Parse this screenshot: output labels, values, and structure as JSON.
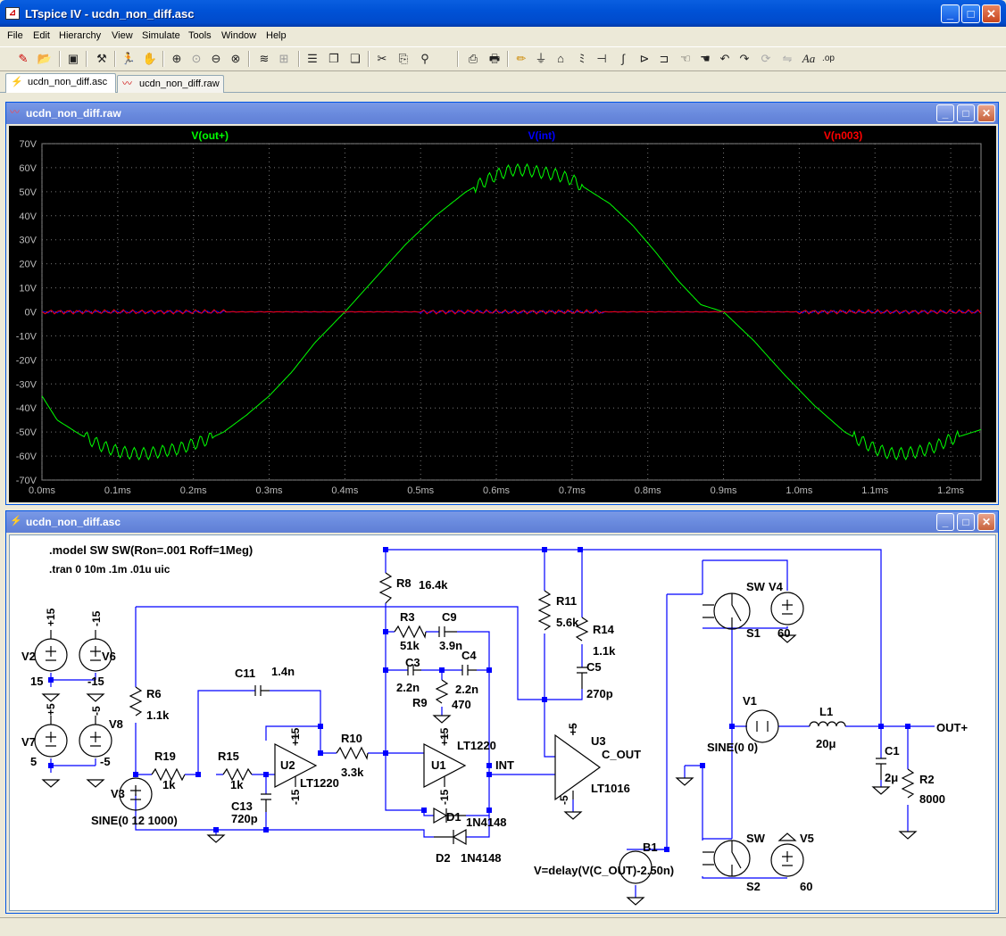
{
  "window": {
    "title": "LTspice IV - ucdn_non_diff.asc"
  },
  "menu": [
    "File",
    "Edit",
    "Hierarchy",
    "View",
    "Simulate",
    "Tools",
    "Window",
    "Help"
  ],
  "tabs": [
    {
      "label": "ucdn_non_diff.asc"
    },
    {
      "label": "ucdn_non_diff.raw"
    }
  ],
  "plot_window": {
    "title": "ucdn_non_diff.raw"
  },
  "schematic_window": {
    "title": "ucdn_non_diff.asc"
  },
  "colors": {
    "trace_out": "#00ff00",
    "trace_int": "#0000ff",
    "trace_n003": "#ff0000",
    "wire": "#0000ff",
    "component": "#000000",
    "junction": "#0000ff"
  },
  "chart_data": {
    "type": "line",
    "series": [
      {
        "name": "V(out+)",
        "color": "#00ff00",
        "x": [
          0.0,
          0.02,
          0.05,
          0.08,
          0.1,
          0.12,
          0.14,
          0.16,
          0.18,
          0.2,
          0.22,
          0.24,
          0.27,
          0.3,
          0.33,
          0.36,
          0.4,
          0.44,
          0.48,
          0.52,
          0.56,
          0.6,
          0.62,
          0.64,
          0.66,
          0.68,
          0.7,
          0.72,
          0.75,
          0.78,
          0.81,
          0.84,
          0.87,
          0.9,
          0.94,
          0.98,
          1.02,
          1.06,
          1.1,
          1.12,
          1.14,
          1.16,
          1.18,
          1.2,
          1.22,
          1.24
        ],
        "y": [
          -35,
          -45,
          -51,
          -56,
          -58,
          -59,
          -59,
          -58,
          -57,
          -55,
          -53,
          -50,
          -43,
          -35,
          -25,
          -13,
          0,
          14,
          28,
          40,
          50,
          57,
          59,
          59,
          58,
          57,
          55,
          51,
          45,
          36,
          25,
          13,
          3,
          0,
          -12,
          -26,
          -39,
          -50,
          -57,
          -59,
          -59,
          -58,
          -56,
          -53,
          -51,
          -49
        ]
      },
      {
        "name": "V(int)",
        "color": "#0000ff",
        "x": [
          0,
          1.24
        ],
        "y": [
          0,
          0
        ]
      },
      {
        "name": "V(n003)",
        "color": "#ff0000",
        "x": [
          0,
          1.24
        ],
        "y": [
          0,
          0
        ]
      }
    ],
    "yticks": [
      "70V",
      "60V",
      "50V",
      "40V",
      "30V",
      "20V",
      "10V",
      "0V",
      "-10V",
      "-20V",
      "-30V",
      "-40V",
      "-50V",
      "-60V",
      "-70V"
    ],
    "xticks": [
      "0.0ms",
      "0.1ms",
      "0.2ms",
      "0.3ms",
      "0.4ms",
      "0.5ms",
      "0.6ms",
      "0.7ms",
      "0.8ms",
      "0.9ms",
      "1.0ms",
      "1.1ms",
      "1.2ms"
    ],
    "ylim": [
      -70,
      70
    ],
    "xlim": [
      0,
      1.24
    ],
    "grid": true
  },
  "schematic": {
    "directives": [
      ".model SW SW(Ron=.001 Roff=1Meg)",
      ".tran 0 10m .1m .01u uic"
    ],
    "labels": {
      "r8": "R8",
      "r8v": "16.4k",
      "r3": "R3",
      "r3v": "51k",
      "c9": "C9",
      "c9v": "3.9n",
      "c3": "C3",
      "c3v": "2.2n",
      "c4": "C4",
      "c4v": "2.2n",
      "r9": "R9",
      "r9v": "470",
      "r11": "R11",
      "r11v": "5.6k",
      "r14": "R14",
      "r14v": "1.1k",
      "c5": "C5",
      "c5v": "270p",
      "r6": "R6",
      "r6v": "1.1k",
      "c11": "C11",
      "c11v": "1.4n",
      "r19": "R19",
      "r19v": "1k",
      "r15": "R15",
      "r15v": "1k",
      "u2": "U2",
      "u2v": "LT1220",
      "r10": "R10",
      "r10v": "3.3k",
      "u1": "U1",
      "u1v": "LT1220",
      "int": "INT",
      "u3": "U3",
      "c_out": "C_OUT",
      "u3v": "LT1016",
      "d1": "D1",
      "d1v": "1N4148",
      "d2": "D2",
      "d2v": "1N4148",
      "c13": "C13",
      "c13v": "720p",
      "v3": "V3",
      "v3v": "SINE(0 12 1000)",
      "v2": "V2",
      "v6": "V6",
      "v7": "V7",
      "v8": "V8",
      "p15a": "+15",
      "n15a": "-15",
      "v15": "15",
      "vm15": "-15",
      "p5": "+5",
      "m5": "-5",
      "five": "5",
      "mfive": "-5",
      "p15u2": "+15",
      "m15u2": "-15",
      "p15u1": "+15",
      "m15u1": "-15",
      "p5u3": "+5",
      "m5u3": "-5",
      "sw1": "SW",
      "s1": "S1",
      "v4": "V4",
      "v4v": "60",
      "v1": "V1",
      "v1v": "SINE(0 0)",
      "l1": "L1",
      "l1v": "20μ",
      "outp": "OUT+",
      "c1": "C1",
      "c1v": "2μ",
      "r2": "R2",
      "r2v": "8000",
      "sw2": "SW",
      "s2": "S2",
      "v5": "V5",
      "v5v": "60",
      "b1": "B1",
      "b1v": "V=delay(V(C_OUT)-2.50n)"
    }
  }
}
